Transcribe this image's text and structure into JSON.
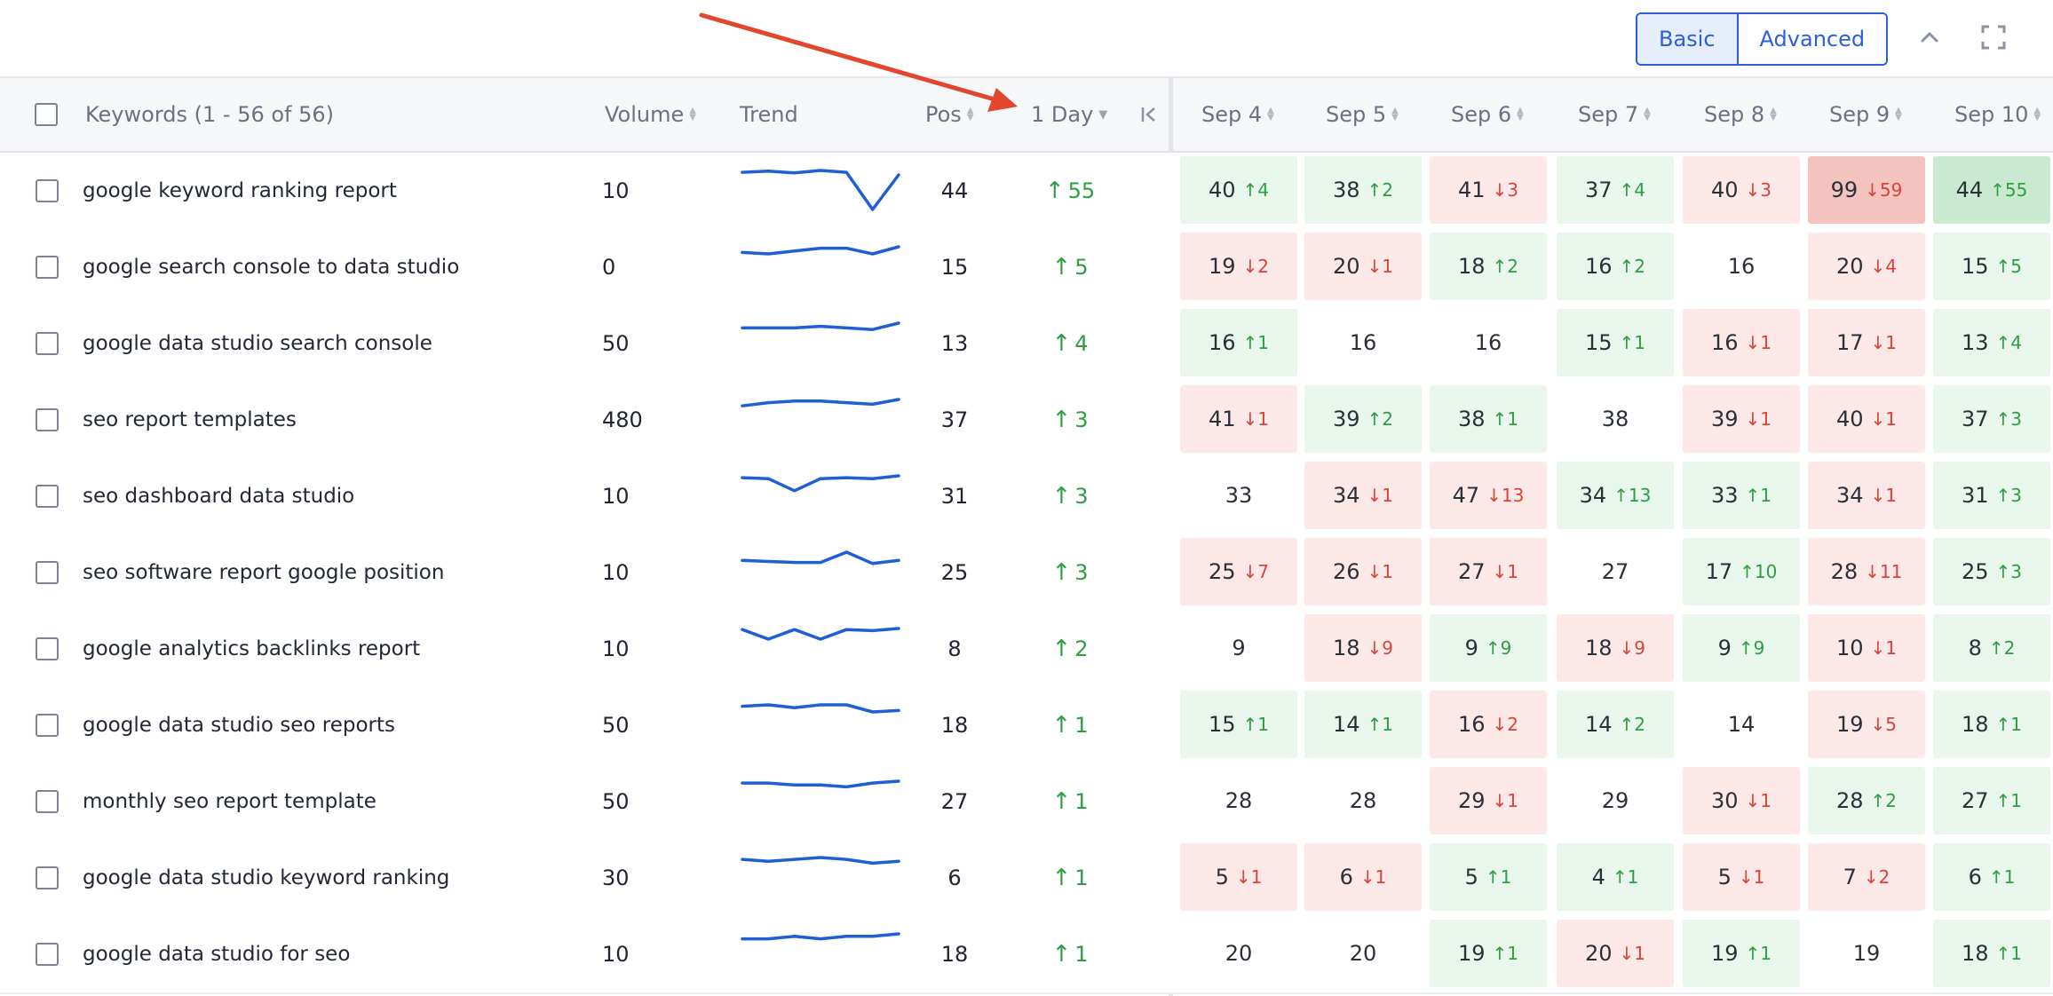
{
  "toolbar": {
    "basic_label": "Basic",
    "advanced_label": "Advanced"
  },
  "header": {
    "keywords_label": "Keywords (1 - 56 of 56)",
    "volume_label": "Volume",
    "trend_label": "Trend",
    "pos_label": "Pos",
    "day_label": "1 Day",
    "dates": [
      "Sep 4",
      "Sep 5",
      "Sep 6",
      "Sep 7",
      "Sep 8",
      "Sep 9",
      "Sep 10"
    ]
  },
  "colors": {
    "accent": "#2b5fd9",
    "up": "#2e9e43",
    "down": "#d9443a",
    "arrow_annotation": "#e2462c",
    "trend_line": "#1f5fd6"
  },
  "icons": {
    "collapse": "chevron-up-icon",
    "fullscreen": "fullscreen-icon",
    "first_page": "first-page-icon",
    "up_arrow": "arrow-up-icon",
    "down_arrow": "arrow-down-icon"
  },
  "rows": [
    {
      "keyword": "google keyword ranking report",
      "volume": "10",
      "pos": "44",
      "day": "55",
      "trend": [
        40,
        38,
        41,
        37,
        40,
        99,
        44
      ],
      "cells": [
        [
          "40",
          "u",
          "4",
          1
        ],
        [
          "38",
          "u",
          "2",
          1
        ],
        [
          "41",
          "d",
          "3",
          1
        ],
        [
          "37",
          "u",
          "4",
          1
        ],
        [
          "40",
          "d",
          "3",
          1
        ],
        [
          "99",
          "d",
          "59",
          2
        ],
        [
          "44",
          "u",
          "55",
          2
        ]
      ]
    },
    {
      "keyword": "google search console to data studio",
      "volume": "0",
      "pos": "15",
      "day": "5",
      "trend": [
        19,
        20,
        18,
        16,
        16,
        20,
        15
      ],
      "cells": [
        [
          "19",
          "d",
          "2",
          1
        ],
        [
          "20",
          "d",
          "1",
          1
        ],
        [
          "18",
          "u",
          "2",
          1
        ],
        [
          "16",
          "u",
          "2",
          1
        ],
        [
          "16",
          "",
          "",
          0
        ],
        [
          "20",
          "d",
          "4",
          1
        ],
        [
          "15",
          "u",
          "5",
          1
        ]
      ]
    },
    {
      "keyword": "google data studio search console",
      "volume": "50",
      "pos": "13",
      "day": "4",
      "trend": [
        16,
        16,
        16,
        15,
        16,
        17,
        13
      ],
      "cells": [
        [
          "16",
          "u",
          "1",
          1
        ],
        [
          "16",
          "",
          "",
          0
        ],
        [
          "16",
          "",
          "",
          0
        ],
        [
          "15",
          "u",
          "1",
          1
        ],
        [
          "16",
          "d",
          "1",
          1
        ],
        [
          "17",
          "d",
          "1",
          1
        ],
        [
          "13",
          "u",
          "4",
          1
        ]
      ]
    },
    {
      "keyword": "seo report templates",
      "volume": "480",
      "pos": "37",
      "day": "3",
      "trend": [
        41,
        39,
        38,
        38,
        39,
        40,
        37
      ],
      "cells": [
        [
          "41",
          "d",
          "1",
          1
        ],
        [
          "39",
          "u",
          "2",
          1
        ],
        [
          "38",
          "u",
          "1",
          1
        ],
        [
          "38",
          "",
          "",
          0
        ],
        [
          "39",
          "d",
          "1",
          1
        ],
        [
          "40",
          "d",
          "1",
          1
        ],
        [
          "37",
          "u",
          "3",
          1
        ]
      ]
    },
    {
      "keyword": "seo dashboard data studio",
      "volume": "10",
      "pos": "31",
      "day": "3",
      "trend": [
        33,
        34,
        47,
        34,
        33,
        34,
        31
      ],
      "cells": [
        [
          "33",
          "",
          "",
          0
        ],
        [
          "34",
          "d",
          "1",
          1
        ],
        [
          "47",
          "d",
          "13",
          1
        ],
        [
          "34",
          "u",
          "13",
          1
        ],
        [
          "33",
          "u",
          "1",
          1
        ],
        [
          "34",
          "d",
          "1",
          1
        ],
        [
          "31",
          "u",
          "3",
          1
        ]
      ]
    },
    {
      "keyword": "seo software report google position",
      "volume": "10",
      "pos": "25",
      "day": "3",
      "trend": [
        25,
        26,
        27,
        27,
        17,
        28,
        25
      ],
      "cells": [
        [
          "25",
          "d",
          "7",
          1
        ],
        [
          "26",
          "d",
          "1",
          1
        ],
        [
          "27",
          "d",
          "1",
          1
        ],
        [
          "27",
          "",
          "",
          0
        ],
        [
          "17",
          "u",
          "10",
          1
        ],
        [
          "28",
          "d",
          "11",
          1
        ],
        [
          "25",
          "u",
          "3",
          1
        ]
      ]
    },
    {
      "keyword": "google analytics backlinks report",
      "volume": "10",
      "pos": "8",
      "day": "2",
      "trend": [
        9,
        18,
        9,
        18,
        9,
        10,
        8
      ],
      "cells": [
        [
          "9",
          "",
          "",
          0
        ],
        [
          "18",
          "d",
          "9",
          1
        ],
        [
          "9",
          "u",
          "9",
          1
        ],
        [
          "18",
          "d",
          "9",
          1
        ],
        [
          "9",
          "u",
          "9",
          1
        ],
        [
          "10",
          "d",
          "1",
          1
        ],
        [
          "8",
          "u",
          "2",
          1
        ]
      ]
    },
    {
      "keyword": "google data studio seo reports",
      "volume": "50",
      "pos": "18",
      "day": "1",
      "trend": [
        15,
        14,
        16,
        14,
        14,
        19,
        18
      ],
      "cells": [
        [
          "15",
          "u",
          "1",
          1
        ],
        [
          "14",
          "u",
          "1",
          1
        ],
        [
          "16",
          "d",
          "2",
          1
        ],
        [
          "14",
          "u",
          "2",
          1
        ],
        [
          "14",
          "",
          "",
          0
        ],
        [
          "19",
          "d",
          "5",
          1
        ],
        [
          "18",
          "u",
          "1",
          1
        ]
      ]
    },
    {
      "keyword": "monthly seo report template",
      "volume": "50",
      "pos": "27",
      "day": "1",
      "trend": [
        28,
        28,
        29,
        29,
        30,
        28,
        27
      ],
      "cells": [
        [
          "28",
          "",
          "",
          0
        ],
        [
          "28",
          "",
          "",
          0
        ],
        [
          "29",
          "d",
          "1",
          1
        ],
        [
          "29",
          "",
          "",
          0
        ],
        [
          "30",
          "d",
          "1",
          1
        ],
        [
          "28",
          "u",
          "2",
          1
        ],
        [
          "27",
          "u",
          "1",
          1
        ]
      ]
    },
    {
      "keyword": "google data studio keyword ranking",
      "volume": "30",
      "pos": "6",
      "day": "1",
      "trend": [
        5,
        6,
        5,
        4,
        5,
        7,
        6
      ],
      "cells": [
        [
          "5",
          "d",
          "1",
          1
        ],
        [
          "6",
          "d",
          "1",
          1
        ],
        [
          "5",
          "u",
          "1",
          1
        ],
        [
          "4",
          "u",
          "1",
          1
        ],
        [
          "5",
          "d",
          "1",
          1
        ],
        [
          "7",
          "d",
          "2",
          1
        ],
        [
          "6",
          "u",
          "1",
          1
        ]
      ]
    },
    {
      "keyword": "google data studio for seo",
      "volume": "10",
      "pos": "18",
      "day": "1",
      "trend": [
        20,
        20,
        19,
        20,
        19,
        19,
        18
      ],
      "cells": [
        [
          "20",
          "",
          "",
          0
        ],
        [
          "20",
          "",
          "",
          0
        ],
        [
          "19",
          "u",
          "1",
          1
        ],
        [
          "20",
          "d",
          "1",
          1
        ],
        [
          "19",
          "u",
          "1",
          1
        ],
        [
          "19",
          "",
          "",
          0
        ],
        [
          "18",
          "u",
          "1",
          1
        ]
      ]
    }
  ]
}
